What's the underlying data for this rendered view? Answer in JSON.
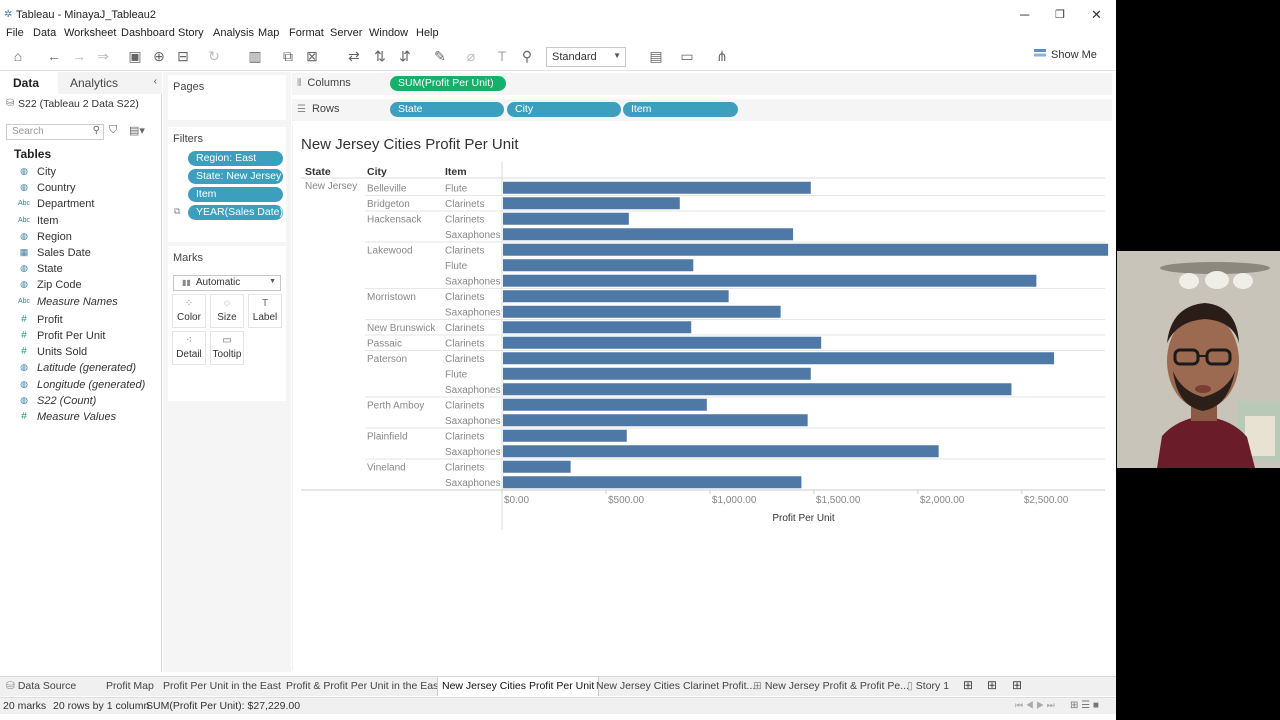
{
  "window": {
    "title": "Tableau - MinayaJ_Tableau2"
  },
  "menu": [
    "File",
    "Data",
    "Worksheet",
    "Dashboard",
    "Story",
    "Analysis",
    "Map",
    "Format",
    "Server",
    "Window",
    "Help"
  ],
  "toolbar": {
    "fit": "Standard",
    "show_me": "Show Me"
  },
  "data_pane": {
    "tab_data": "Data",
    "tab_analytics": "Analytics",
    "source": "S22 (Tableau 2 Data S22)",
    "search_placeholder": "Search",
    "tables_heading": "Tables",
    "fields": [
      {
        "label": "City",
        "kind": "geo"
      },
      {
        "label": "Country",
        "kind": "geo"
      },
      {
        "label": "Department",
        "kind": "abc"
      },
      {
        "label": "Item",
        "kind": "abc"
      },
      {
        "label": "Region",
        "kind": "geo"
      },
      {
        "label": "Sales Date",
        "kind": "date"
      },
      {
        "label": "State",
        "kind": "geo"
      },
      {
        "label": "Zip Code",
        "kind": "geo"
      },
      {
        "label": "Measure Names",
        "kind": "abc",
        "italic": true
      },
      {
        "label": "Profit",
        "kind": "measure"
      },
      {
        "label": "Profit Per Unit",
        "kind": "measure"
      },
      {
        "label": "Units Sold",
        "kind": "measure"
      },
      {
        "label": "Latitude (generated)",
        "kind": "geo",
        "italic": true
      },
      {
        "label": "Longitude (generated)",
        "kind": "geo",
        "italic": true
      },
      {
        "label": "S22 (Count)",
        "kind": "geo",
        "italic": true
      },
      {
        "label": "Measure Values",
        "kind": "measure",
        "italic": true
      }
    ]
  },
  "pages": {
    "heading": "Pages"
  },
  "filters": {
    "heading": "Filters",
    "items": [
      "Region: East",
      "State: New Jersey",
      "Item",
      "YEAR(Sales Date)"
    ]
  },
  "marks": {
    "heading": "Marks",
    "type": "Automatic",
    "buttons": [
      "Color",
      "Size",
      "Label",
      "Detail",
      "Tooltip"
    ]
  },
  "shelves": {
    "columns_label": "Columns",
    "rows_label": "Rows",
    "columns": [
      "SUM(Profit Per Unit)"
    ],
    "rows": [
      "State",
      "City",
      "Item"
    ]
  },
  "viz": {
    "title": "New Jersey Cities Profit Per Unit",
    "headers": [
      "State",
      "City",
      "Item"
    ]
  },
  "chart_data": {
    "type": "bar",
    "orientation": "horizontal",
    "title": "New Jersey Cities Profit Per Unit",
    "xlabel": "Profit Per Unit",
    "xlim": [
      0,
      2900
    ],
    "x_ticks": [
      "$0.00",
      "$500.00",
      "$1,000.00",
      "$1,500.00",
      "$2,000.00",
      "$2,500.00"
    ],
    "bar_color": "#4e79a7",
    "state": "New Jersey",
    "rows": [
      {
        "city": "Belleville",
        "item": "Flute",
        "value": 1485
      },
      {
        "city": "Bridgeton",
        "item": "Clarinets",
        "value": 855
      },
      {
        "city": "Hackensack",
        "item": "Clarinets",
        "value": 610
      },
      {
        "city": "",
        "item": "Saxaphones",
        "value": 1400
      },
      {
        "city": "Lakewood",
        "item": "Clarinets",
        "value": 2915
      },
      {
        "city": "",
        "item": "Flute",
        "value": 920
      },
      {
        "city": "",
        "item": "Saxaphones",
        "value": 2570
      },
      {
        "city": "Morristown",
        "item": "Clarinets",
        "value": 1090
      },
      {
        "city": "",
        "item": "Saxaphones",
        "value": 1340
      },
      {
        "city": "New Brunswick",
        "item": "Clarinets",
        "value": 910
      },
      {
        "city": "Passaic",
        "item": "Clarinets",
        "value": 1535
      },
      {
        "city": "Paterson",
        "item": "Clarinets",
        "value": 2655
      },
      {
        "city": "",
        "item": "Flute",
        "value": 1485
      },
      {
        "city": "",
        "item": "Saxaphones",
        "value": 2450
      },
      {
        "city": "Perth Amboy",
        "item": "Clarinets",
        "value": 985
      },
      {
        "city": "",
        "item": "Saxaphones",
        "value": 1470
      },
      {
        "city": "Plainfield",
        "item": "Clarinets",
        "value": 600
      },
      {
        "city": "",
        "item": "Saxaphones",
        "value": 2100
      },
      {
        "city": "Vineland",
        "item": "Clarinets",
        "value": 330
      },
      {
        "city": "",
        "item": "Saxaphones",
        "value": 1440
      }
    ]
  },
  "sheet_tabs": [
    "Data Source",
    "Profit Map",
    "Profit Per Unit in the East",
    "Profit & Profit Per Unit in the East",
    "New Jersey Cities Profit Per Unit",
    "New Jersey Cities Clarinet Profit...",
    "New Jersey Profit & Profit Pe...",
    "Story 1"
  ],
  "status": {
    "marks": "20 marks",
    "dims": "20 rows by 1 column",
    "sum": "SUM(Profit Per Unit): $27,229.00"
  }
}
